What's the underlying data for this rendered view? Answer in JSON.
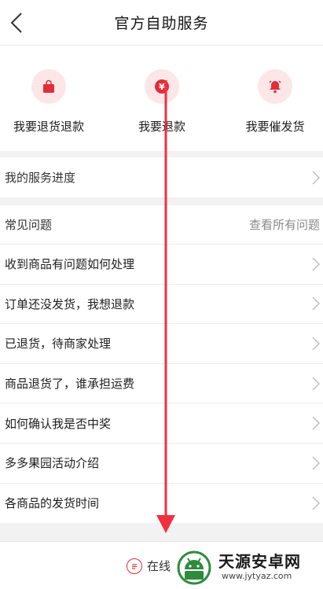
{
  "header": {
    "title": "官方自助服务"
  },
  "quick_actions": [
    {
      "label": "我要退货退款",
      "icon": "shopping-bag-icon"
    },
    {
      "label": "我要退款",
      "icon": "yen-icon"
    },
    {
      "label": "我要催发货",
      "icon": "bell-icon"
    }
  ],
  "progress": {
    "label": "我的服务进度"
  },
  "faq": {
    "title": "常见问题",
    "see_all": "查看所有问题",
    "items": [
      "收到商品有问题如何处理",
      "订单还没发货，我想退款",
      "已退货，待商家处理",
      "商品退货了，谁承担运费",
      "如何确认我是否中奖",
      "多多果园活动介绍",
      "各商品的发货时间"
    ]
  },
  "bottom": {
    "cs_label": "在线"
  },
  "watermark": {
    "name": "天源安卓网",
    "url": "www.jytyaz.com"
  },
  "colors": {
    "accent": "#e02e3b",
    "icon_bg": "#fde6e8",
    "arrow": "#f1303f"
  }
}
